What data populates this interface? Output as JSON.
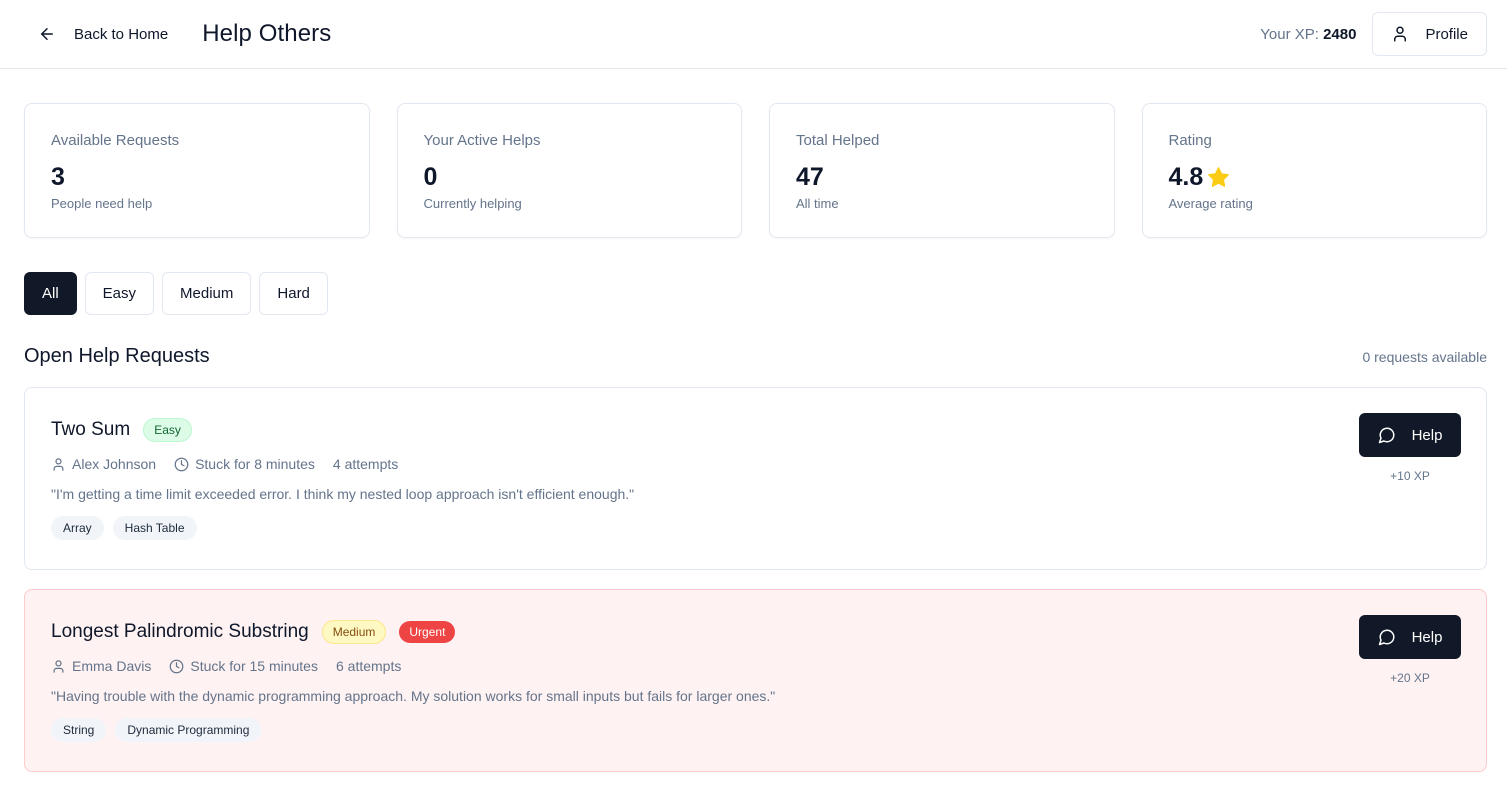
{
  "header": {
    "back_label": "Back to Home",
    "title": "Help Others",
    "xp_label": "Your XP:",
    "xp_value": "2480",
    "profile_label": "Profile"
  },
  "stats": [
    {
      "label": "Available Requests",
      "value": "3",
      "sub": "People need help"
    },
    {
      "label": "Your Active Helps",
      "value": "0",
      "sub": "Currently helping"
    },
    {
      "label": "Total Helped",
      "value": "47",
      "sub": "All time"
    },
    {
      "label": "Rating",
      "value": "4.8",
      "sub": "Average rating",
      "icon": "star-icon"
    }
  ],
  "filters": [
    "All",
    "Easy",
    "Medium",
    "Hard"
  ],
  "active_filter": "All",
  "section": {
    "title": "Open Help Requests",
    "count": "0 requests available"
  },
  "requests": [
    {
      "title": "Two Sum",
      "difficulty": "Easy",
      "user": "Alex Johnson",
      "stuck": "Stuck for 8 minutes",
      "attempts": "4 attempts",
      "quote": "\"I'm getting a time limit exceeded error. I think my nested loop approach isn't efficient enough.\"",
      "tags": [
        "Array",
        "Hash Table"
      ],
      "help_label": "Help",
      "xp": "+10 XP"
    },
    {
      "title": "Longest Palindromic Substring",
      "difficulty": "Medium",
      "urgent": "Urgent",
      "user": "Emma Davis",
      "stuck": "Stuck for 15 minutes",
      "attempts": "6 attempts",
      "quote": "\"Having trouble with the dynamic programming approach. My solution works for small inputs but fails for larger ones.\"",
      "tags": [
        "String",
        "Dynamic Programming"
      ],
      "help_label": "Help",
      "xp": "+20 XP"
    }
  ],
  "colors": {
    "primary": "#111827",
    "muted": "#64748b",
    "urgent_bg": "#fef2f2",
    "star": "#facc15"
  }
}
